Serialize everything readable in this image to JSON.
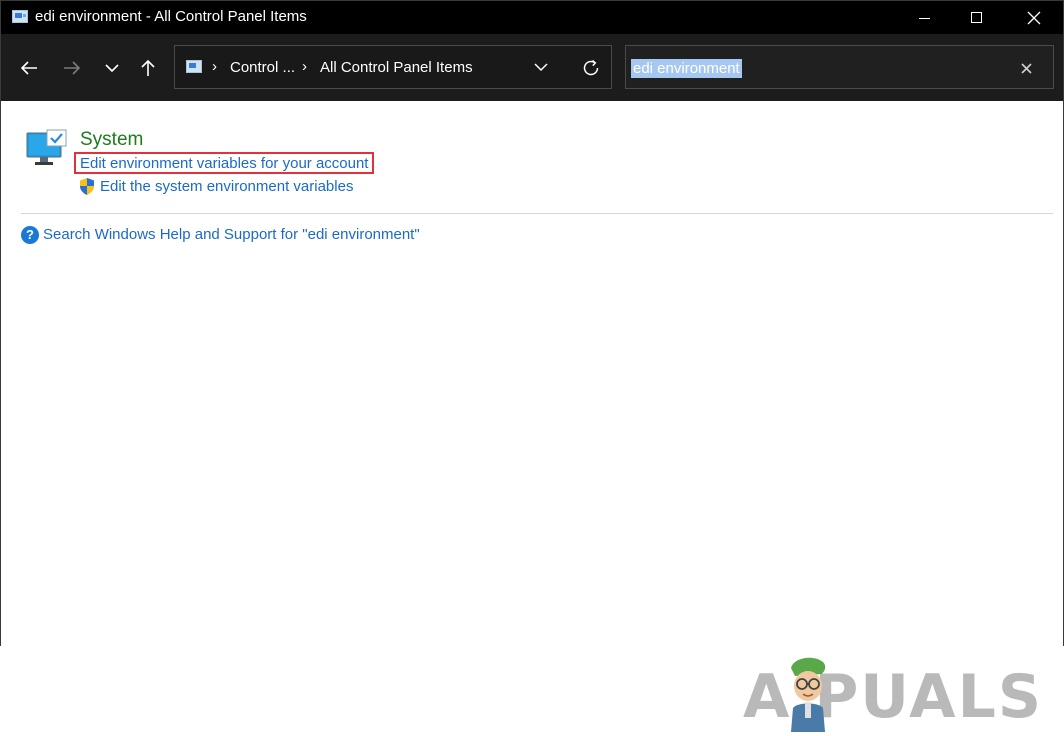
{
  "window": {
    "title": "edi environment - All Control Panel Items"
  },
  "navigation": {
    "breadcrumbs": [
      "Control ...",
      "All Control Panel Items"
    ],
    "search_value": "edi environment"
  },
  "results": {
    "group_title": "System",
    "links": [
      "Edit environment variables for your account",
      "Edit the system environment variables"
    ],
    "help_link": "Search Windows Help and Support for \"edi environment\""
  },
  "watermark": {
    "text": "A  PUALS"
  },
  "colors": {
    "titlebar_bg": "#000000",
    "navbar_bg": "#1c1c1c",
    "link": "#1b6ac9",
    "group_title": "#1e7b1e",
    "highlight_border": "#e0323a",
    "search_selection": "#a6c8f0"
  }
}
